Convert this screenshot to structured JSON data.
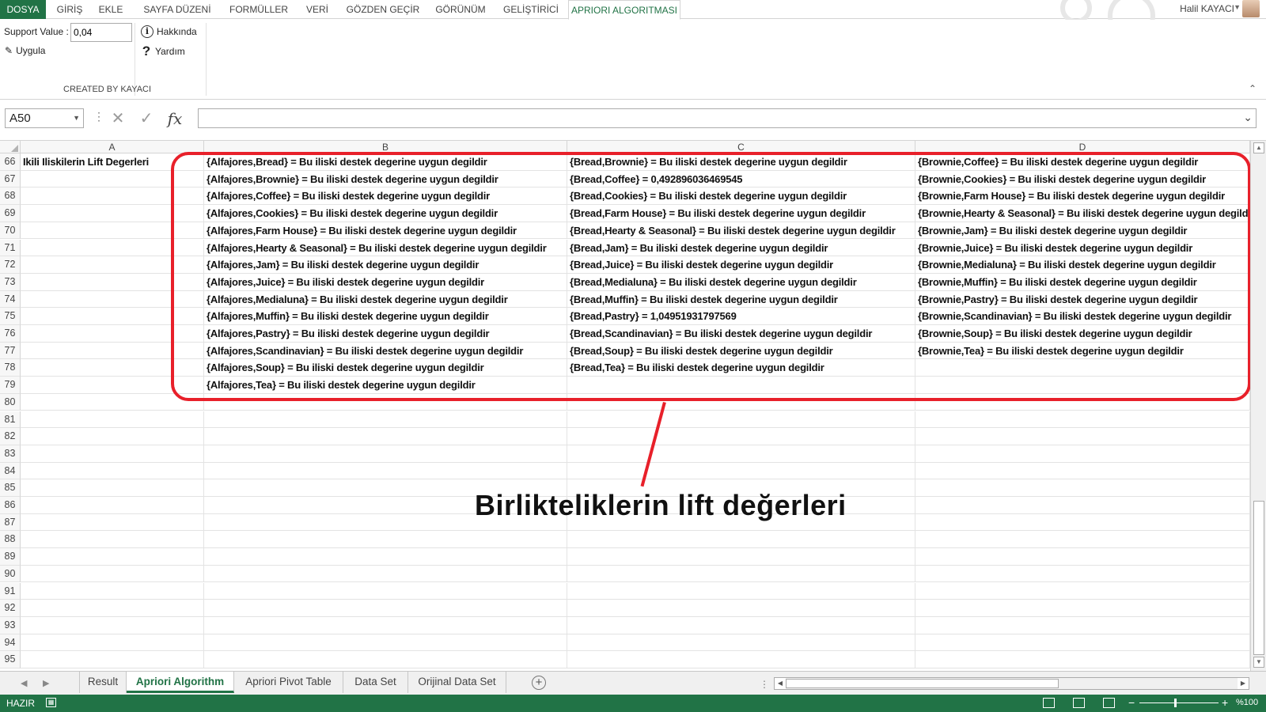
{
  "ribbon_tabs": {
    "file": "DOSYA",
    "items": [
      "GİRİŞ",
      "EKLE",
      "SAYFA DÜZENİ",
      "FORMÜLLER",
      "VERİ",
      "GÖZDEN GEÇİR",
      "GÖRÜNÜM",
      "GELİŞTİRİCİ",
      "APRIORI ALGORITMASI"
    ],
    "active": "APRIORI ALGORITMASI"
  },
  "user": {
    "name": "Halil KAYACI"
  },
  "ribbon": {
    "support_label": "Support Value :",
    "support_value": "0,04",
    "apply_label": "Uygula",
    "about_label": "Hakkında",
    "help_label": "Yardım",
    "group_label": "CREATED BY KAYACI"
  },
  "formula_bar": {
    "name_box": "A50",
    "formula": ""
  },
  "columns": [
    "A",
    "B",
    "C",
    "D"
  ],
  "rows": [
    {
      "num": "66",
      "A": "Ikili Iliskilerin Lift Degerleri",
      "B": "{Alfajores,Bread} = Bu iliski destek degerine uygun degildir",
      "C": "{Bread,Brownie} = Bu iliski destek degerine uygun degildir",
      "D": "{Brownie,Coffee} = Bu iliski destek degerine uygun degildir"
    },
    {
      "num": "67",
      "A": "",
      "B": "{Alfajores,Brownie} = Bu iliski destek degerine uygun degildir",
      "C": "{Bread,Coffee} = 0,492896036469545",
      "D": "{Brownie,Cookies} = Bu iliski destek degerine uygun degildir"
    },
    {
      "num": "68",
      "A": "",
      "B": "{Alfajores,Coffee} = Bu iliski destek degerine uygun degildir",
      "C": "{Bread,Cookies} = Bu iliski destek degerine uygun degildir",
      "D": "{Brownie,Farm House} = Bu iliski destek degerine uygun degildir"
    },
    {
      "num": "69",
      "A": "",
      "B": "{Alfajores,Cookies} = Bu iliski destek degerine uygun degildir",
      "C": "{Bread,Farm House} = Bu iliski destek degerine uygun degildir",
      "D": "{Brownie,Hearty & Seasonal} = Bu iliski destek degerine uygun degildir"
    },
    {
      "num": "70",
      "A": "",
      "B": "{Alfajores,Farm House} = Bu iliski destek degerine uygun degildir",
      "C": "{Bread,Hearty & Seasonal} = Bu iliski destek degerine uygun degildir",
      "D": "{Brownie,Jam} = Bu iliski destek degerine uygun degildir"
    },
    {
      "num": "71",
      "A": "",
      "B": "{Alfajores,Hearty & Seasonal} = Bu iliski destek degerine uygun degildir",
      "C": "{Bread,Jam} = Bu iliski destek degerine uygun degildir",
      "D": "{Brownie,Juice} = Bu iliski destek degerine uygun degildir"
    },
    {
      "num": "72",
      "A": "",
      "B": "{Alfajores,Jam} = Bu iliski destek degerine uygun degildir",
      "C": "{Bread,Juice} = Bu iliski destek degerine uygun degildir",
      "D": "{Brownie,Medialuna} = Bu iliski destek degerine uygun degildir"
    },
    {
      "num": "73",
      "A": "",
      "B": "{Alfajores,Juice} = Bu iliski destek degerine uygun degildir",
      "C": "{Bread,Medialuna} = Bu iliski destek degerine uygun degildir",
      "D": "{Brownie,Muffin} = Bu iliski destek degerine uygun degildir"
    },
    {
      "num": "74",
      "A": "",
      "B": "{Alfajores,Medialuna} = Bu iliski destek degerine uygun degildir",
      "C": "{Bread,Muffin} = Bu iliski destek degerine uygun degildir",
      "D": "{Brownie,Pastry} = Bu iliski destek degerine uygun degildir"
    },
    {
      "num": "75",
      "A": "",
      "B": "{Alfajores,Muffin} = Bu iliski destek degerine uygun degildir",
      "C": "{Bread,Pastry} = 1,04951931797569",
      "D": "{Brownie,Scandinavian} = Bu iliski destek degerine uygun degildir"
    },
    {
      "num": "76",
      "A": "",
      "B": "{Alfajores,Pastry} = Bu iliski destek degerine uygun degildir",
      "C": "{Bread,Scandinavian} = Bu iliski destek degerine uygun degildir",
      "D": "{Brownie,Soup} = Bu iliski destek degerine uygun degildir"
    },
    {
      "num": "77",
      "A": "",
      "B": "{Alfajores,Scandinavian} = Bu iliski destek degerine uygun degildir",
      "C": "{Bread,Soup} = Bu iliski destek degerine uygun degildir",
      "D": "{Brownie,Tea} = Bu iliski destek degerine uygun degildir"
    },
    {
      "num": "78",
      "A": "",
      "B": "{Alfajores,Soup} = Bu iliski destek degerine uygun degildir",
      "C": "{Bread,Tea} = Bu iliski destek degerine uygun degildir",
      "D": ""
    },
    {
      "num": "79",
      "A": "",
      "B": "{Alfajores,Tea} = Bu iliski destek degerine uygun degildir",
      "C": "",
      "D": ""
    },
    {
      "num": "80",
      "A": "",
      "B": "",
      "C": "",
      "D": ""
    },
    {
      "num": "81",
      "A": "",
      "B": "",
      "C": "",
      "D": ""
    },
    {
      "num": "82",
      "A": "",
      "B": "",
      "C": "",
      "D": ""
    },
    {
      "num": "83",
      "A": "",
      "B": "",
      "C": "",
      "D": ""
    },
    {
      "num": "84",
      "A": "",
      "B": "",
      "C": "",
      "D": ""
    },
    {
      "num": "85",
      "A": "",
      "B": "",
      "C": "",
      "D": ""
    },
    {
      "num": "86",
      "A": "",
      "B": "",
      "C": "",
      "D": ""
    },
    {
      "num": "87",
      "A": "",
      "B": "",
      "C": "",
      "D": ""
    },
    {
      "num": "88",
      "A": "",
      "B": "",
      "C": "",
      "D": ""
    },
    {
      "num": "89",
      "A": "",
      "B": "",
      "C": "",
      "D": ""
    },
    {
      "num": "90",
      "A": "",
      "B": "",
      "C": "",
      "D": ""
    },
    {
      "num": "91",
      "A": "",
      "B": "",
      "C": "",
      "D": ""
    },
    {
      "num": "92",
      "A": "",
      "B": "",
      "C": "",
      "D": ""
    },
    {
      "num": "93",
      "A": "",
      "B": "",
      "C": "",
      "D": ""
    },
    {
      "num": "94",
      "A": "",
      "B": "",
      "C": "",
      "D": ""
    },
    {
      "num": "95",
      "A": "",
      "B": "",
      "C": "",
      "D": ""
    }
  ],
  "annotation": {
    "text": "Birlikteliklerin lift değerleri",
    "color": "#e8202a"
  },
  "sheet_tabs": {
    "items": [
      "Result",
      "Apriori Algorithm",
      "Apriori Pivot Table",
      "Data Set",
      "Orijinal Data Set"
    ],
    "active": "Apriori Algorithm"
  },
  "status_bar": {
    "ready": "HAZIR",
    "zoom": "%100"
  },
  "colors": {
    "excel_green": "#217346"
  }
}
